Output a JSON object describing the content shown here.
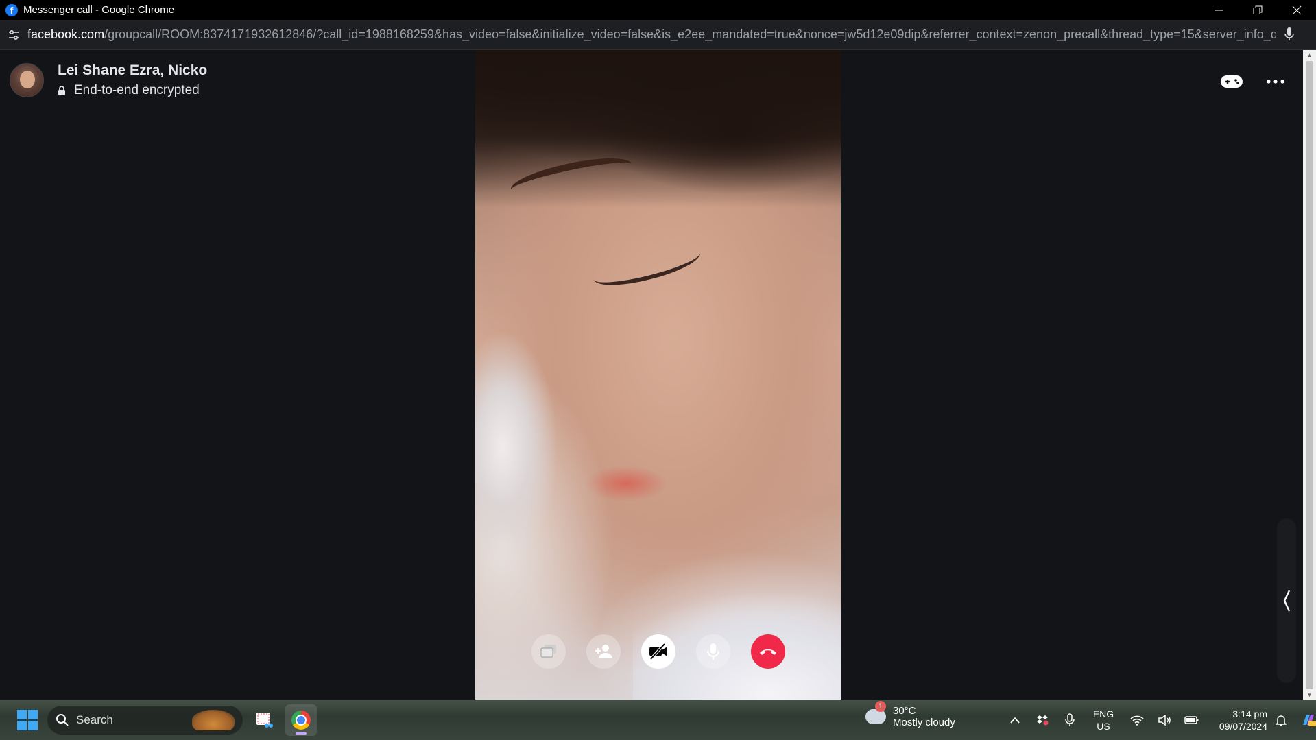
{
  "browser": {
    "window_title": "Messenger call - Google Chrome",
    "url_host": "facebook.com",
    "url_rest": "/groupcall/ROOM:8374171932612846/?call_id=1988168259&has_video=false&initialize_video=false&is_e2ee_mandated=true&nonce=jw5d12e09dip&referrer_context=zenon_precall&thread_type=15&server_info_data=..."
  },
  "call": {
    "participants": "Lei Shane Ezra, Nicko",
    "encryption": "End-to-end encrypted",
    "end_call_color": "#f02849"
  },
  "taskbar": {
    "search_label": "Search",
    "weather_badge": "1",
    "weather_temp": "30°C",
    "weather_condition": "Mostly cloudy",
    "lang_line1": "ENG",
    "lang_line2": "US",
    "time": "3:14 pm",
    "date": "09/07/2024"
  }
}
